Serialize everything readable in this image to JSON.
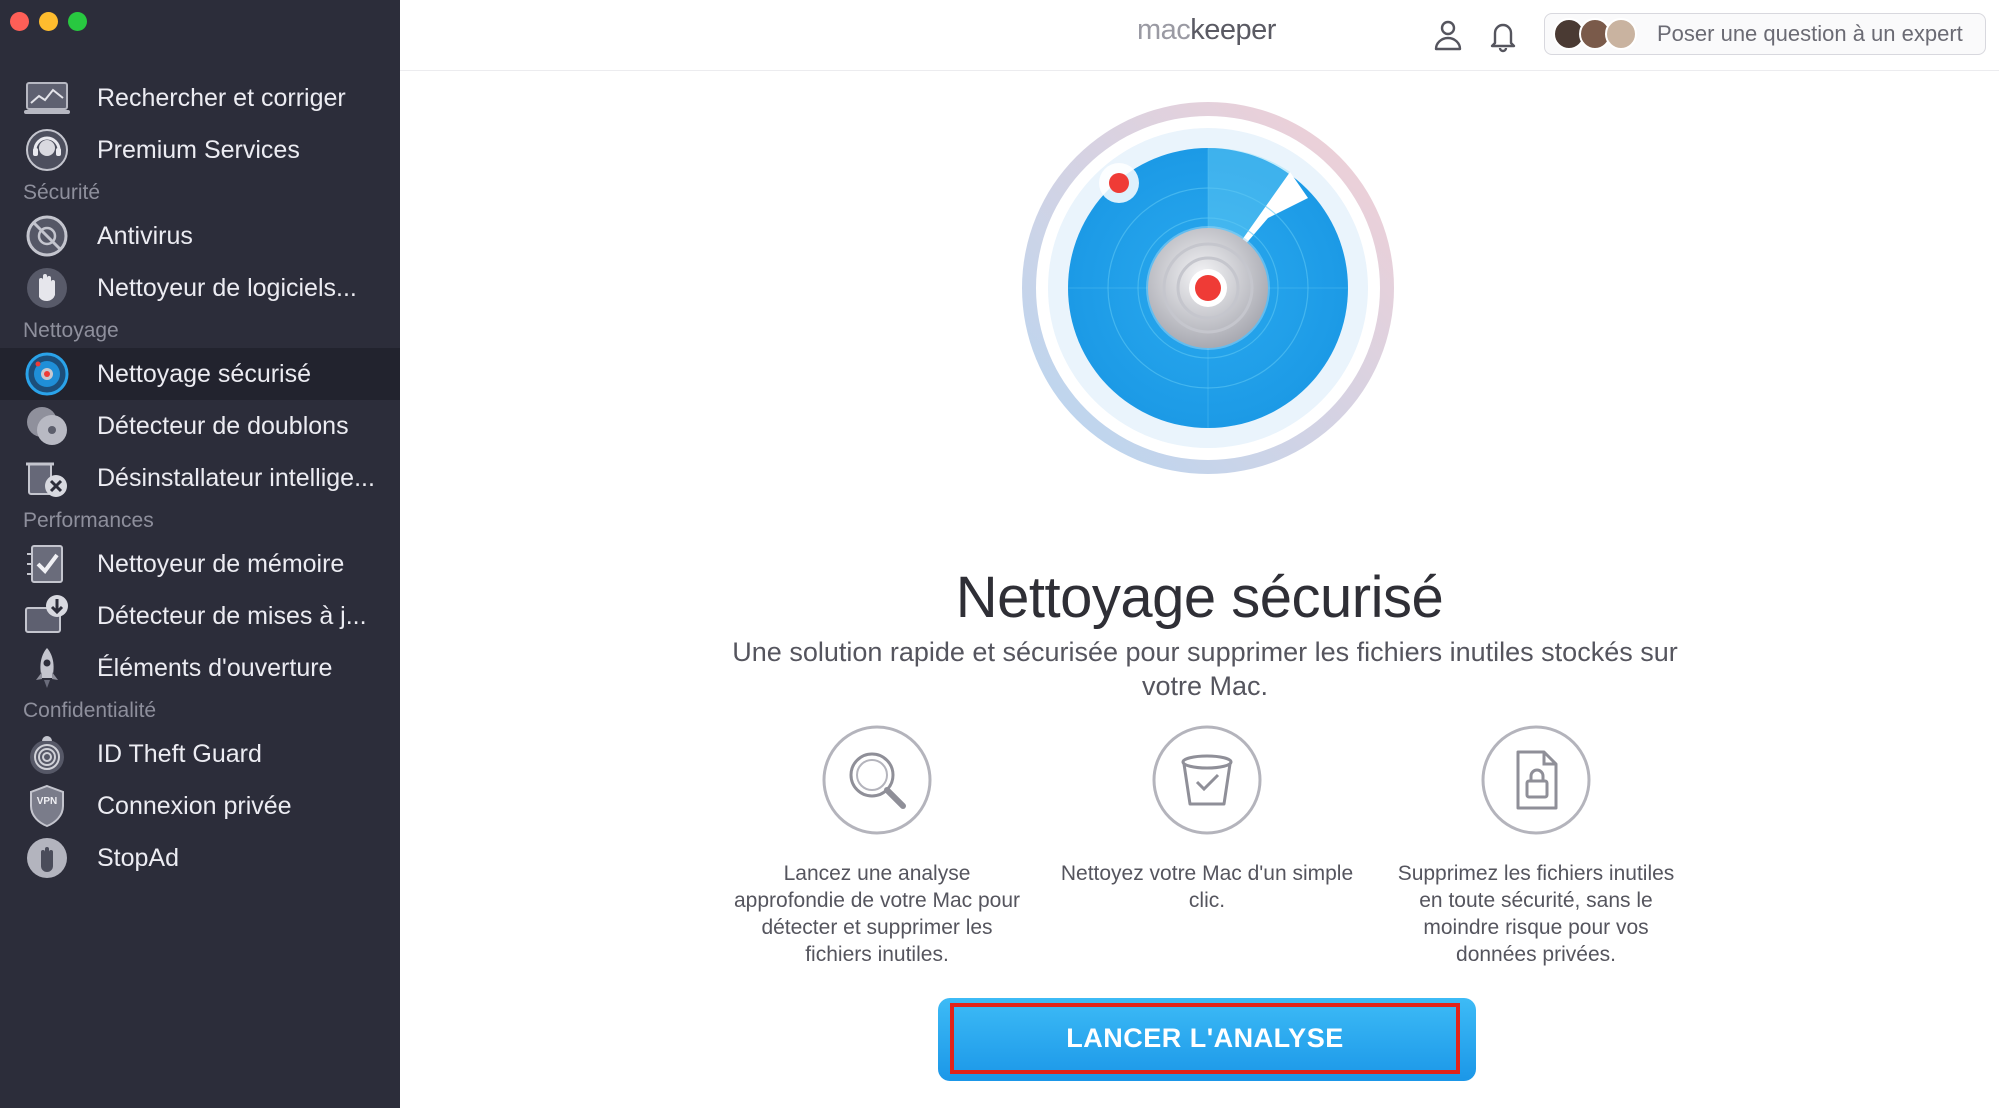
{
  "window": {
    "traffic_lights": {
      "close": "#fe5f57",
      "minimize": "#febc2e",
      "zoom": "#28c840"
    }
  },
  "sidebar": {
    "top_items": [
      {
        "label": "Rechercher et corriger",
        "icon": "laptop-scan-icon"
      },
      {
        "label": "Premium Services",
        "icon": "headset-support-icon"
      }
    ],
    "sections": [
      {
        "label": "Sécurité",
        "items": [
          {
            "label": "Antivirus",
            "icon": "antivirus-icon"
          },
          {
            "label": "Nettoyeur de logiciels...",
            "icon": "hand-stop-icon"
          }
        ]
      },
      {
        "label": "Nettoyage",
        "items": [
          {
            "label": "Nettoyage sécurisé",
            "icon": "radar-icon",
            "active": true
          },
          {
            "label": "Détecteur de doublons",
            "icon": "duplicates-icon"
          },
          {
            "label": "Désinstallateur intellige...",
            "icon": "uninstaller-icon"
          }
        ]
      },
      {
        "label": "Performances",
        "items": [
          {
            "label": "Nettoyeur de mémoire",
            "icon": "memory-checklist-icon"
          },
          {
            "label": "Détecteur de mises à j...",
            "icon": "update-download-icon"
          },
          {
            "label": "Éléments d'ouverture",
            "icon": "rocket-icon"
          }
        ]
      },
      {
        "label": "Confidentialité",
        "items": [
          {
            "label": "ID Theft Guard",
            "icon": "fingerprint-icon"
          },
          {
            "label": "Connexion privée",
            "icon": "vpn-shield-icon"
          },
          {
            "label": "StopAd",
            "icon": "stopad-hand-icon"
          }
        ]
      }
    ]
  },
  "header": {
    "brand_prefix": "mac",
    "brand_suffix": "keeper",
    "expert_button_label": "Poser une question à un expert",
    "icons": [
      "account-icon",
      "bell-icon"
    ]
  },
  "main": {
    "title": "Nettoyage sécurisé",
    "subtitle": "Une solution rapide et sécurisée pour supprimer les fichiers inutiles stockés sur votre Mac.",
    "features": [
      {
        "icon": "magnifier-icon",
        "text": "Lancez une analyse approfondie de votre Mac pour détecter et supprimer les fichiers inutiles."
      },
      {
        "icon": "trash-check-icon",
        "text": "Nettoyez votre Mac d'un simple clic."
      },
      {
        "icon": "locked-file-icon",
        "text": "Supprimez les fichiers inutiles en toute sécurité, sans le moindre risque pour vos données privées."
      }
    ],
    "cta_label": "LANCER L'ANALYSE"
  },
  "colors": {
    "sidebar_bg": "#2c2d3a",
    "sidebar_active_bg": "#22232e",
    "accent_blue": "#1fa5f0",
    "highlight_red": "#e2231a"
  }
}
